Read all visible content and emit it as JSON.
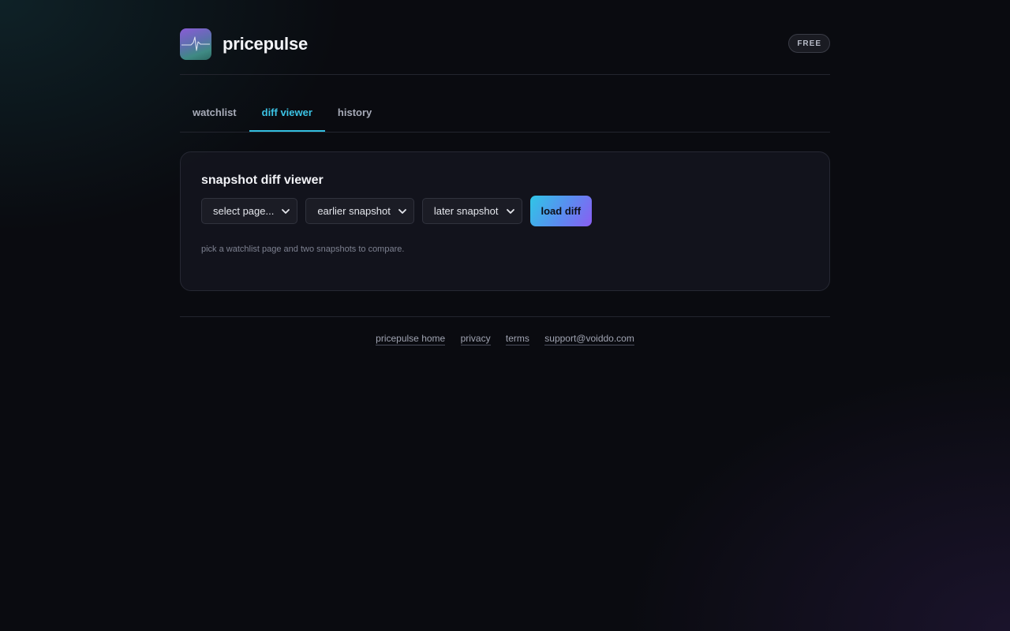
{
  "app": {
    "name": "pricepulse",
    "plan_badge": "FREE"
  },
  "tabs": [
    {
      "label": "watchlist",
      "active": false
    },
    {
      "label": "diff viewer",
      "active": true
    },
    {
      "label": "history",
      "active": false
    }
  ],
  "diff_viewer": {
    "title": "snapshot diff viewer",
    "page_select": {
      "value": "select page..."
    },
    "earlier_select": {
      "value": "earlier snapshot"
    },
    "later_select": {
      "value": "later snapshot"
    },
    "load_button": "load diff",
    "hint": "pick a watchlist page and two snapshots to compare."
  },
  "footer": {
    "links": [
      "pricepulse home",
      "privacy",
      "terms",
      "support@voiddo.com"
    ]
  },
  "colors": {
    "accent": "#33bedf",
    "button_gradient_start": "#2fc6e6",
    "button_gradient_end": "#8a5ef2",
    "background": "#0a0b10"
  },
  "icons": {
    "logo": "pulse-line-icon",
    "select_arrow": "chevron-down-icon"
  }
}
